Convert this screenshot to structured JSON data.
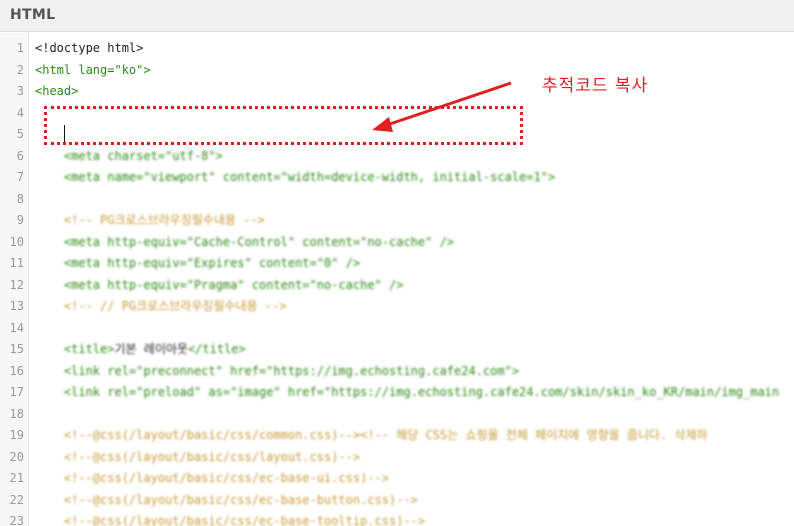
{
  "panel": {
    "title": "HTML"
  },
  "annotation": {
    "text": "추적코드 복사",
    "color": "#e02020"
  },
  "lines": [
    {
      "n": "1",
      "segments": [
        {
          "t": "<!doctype html>",
          "c": "plain"
        }
      ]
    },
    {
      "n": "2",
      "segments": [
        {
          "t": "<html lang=\"ko\">",
          "c": "tag"
        }
      ]
    },
    {
      "n": "3",
      "segments": [
        {
          "t": "<head>",
          "c": "tag"
        }
      ]
    },
    {
      "n": "4",
      "segments": []
    },
    {
      "n": "5",
      "segments": []
    },
    {
      "n": "6",
      "segments": [
        {
          "t": "    <meta charset=\"utf-8\">",
          "c": "tag"
        }
      ]
    },
    {
      "n": "7",
      "segments": [
        {
          "t": "    <meta name=\"viewport\" content=\"width=device-width, initial-scale=1\">",
          "c": "tag"
        }
      ]
    },
    {
      "n": "8",
      "segments": []
    },
    {
      "n": "9",
      "segments": [
        {
          "t": "    <!-- PG크로스브라우징필수내용 -->",
          "c": "cmt"
        }
      ]
    },
    {
      "n": "10",
      "segments": [
        {
          "t": "    <meta http-equiv=\"Cache-Control\" content=\"no-cache\" />",
          "c": "tag"
        }
      ]
    },
    {
      "n": "11",
      "segments": [
        {
          "t": "    <meta http-equiv=\"Expires\" content=\"0\" />",
          "c": "tag"
        }
      ]
    },
    {
      "n": "12",
      "segments": [
        {
          "t": "    <meta http-equiv=\"Pragma\" content=\"no-cache\" />",
          "c": "tag"
        }
      ]
    },
    {
      "n": "13",
      "segments": [
        {
          "t": "    <!-- // PG크로스브라우징필수내용 -->",
          "c": "cmt"
        }
      ]
    },
    {
      "n": "14",
      "segments": []
    },
    {
      "n": "15",
      "segments": [
        {
          "t": "    <title>",
          "c": "tag"
        },
        {
          "t": "기본 레이아웃",
          "c": "plain"
        },
        {
          "t": "</title>",
          "c": "tag"
        }
      ]
    },
    {
      "n": "16",
      "segments": [
        {
          "t": "    <link rel=\"preconnect\" href=\"https://img.echosting.cafe24.com\">",
          "c": "tag"
        }
      ]
    },
    {
      "n": "17",
      "segments": [
        {
          "t": "    <link rel=\"preload\" as=\"image\" href=\"https://img.echosting.cafe24.com/skin/skin_ko_KR/main/img_main",
          "c": "tag"
        }
      ]
    },
    {
      "n": "18",
      "segments": []
    },
    {
      "n": "19",
      "segments": [
        {
          "t": "    <!--@css(/layout/basic/css/common.css)--><!-- 해당 CSS는 쇼핑몰 전체 페이지에 영향을 줍니다. 삭제하",
          "c": "cmt"
        }
      ]
    },
    {
      "n": "20",
      "segments": [
        {
          "t": "    <!--@css(/layout/basic/css/layout.css)-->",
          "c": "cmt"
        }
      ]
    },
    {
      "n": "21",
      "segments": [
        {
          "t": "    <!--@css(/layout/basic/css/ec-base-ui.css)-->",
          "c": "cmt"
        }
      ]
    },
    {
      "n": "22",
      "segments": [
        {
          "t": "    <!--@css(/layout/basic/css/ec-base-button.css)-->",
          "c": "cmt"
        }
      ]
    },
    {
      "n": "23",
      "segments": [
        {
          "t": "    <!--@css(/layout/basic/css/ec-base-tooltip.css)-->",
          "c": "cmt"
        }
      ]
    }
  ]
}
